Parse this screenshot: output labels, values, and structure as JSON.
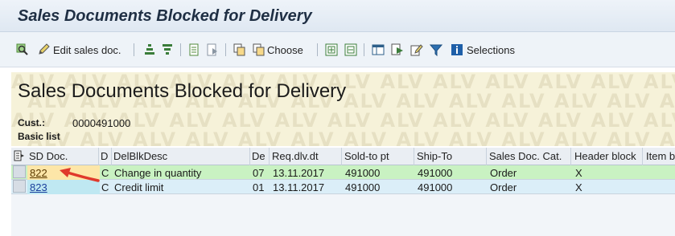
{
  "window": {
    "title": "Sales Documents Blocked for Delivery"
  },
  "toolbar": {
    "edit_label": "Edit sales doc.",
    "choose_label": "Choose",
    "selections_label": "Selections"
  },
  "header": {
    "title": "Sales Documents Blocked for Delivery",
    "cust_label": "Cust.:",
    "cust_value": "0000491000",
    "basic_list": "Basic list",
    "watermark": "ALV"
  },
  "table": {
    "columns": [
      "SD Doc.",
      "D",
      "DelBlkDesc",
      "De",
      "Req.dlv.dt",
      "Sold-to pt",
      "Ship-To",
      "Sales Doc. Cat.",
      "Header block",
      "Item b"
    ],
    "rows": [
      {
        "sd_doc": "822",
        "d": "C",
        "desc": "Change in quantity",
        "de": "07",
        "req_dlv": "13.11.2017",
        "sold_to": "491000",
        "ship_to": "491000",
        "cat": "Order",
        "header_block": "X"
      },
      {
        "sd_doc": "823",
        "d": "C",
        "desc": "Credit limit",
        "de": "01",
        "req_dlv": "13.11.2017",
        "sold_to": "491000",
        "ship_to": "491000",
        "cat": "Order",
        "header_block": "X"
      }
    ]
  },
  "colors": {
    "row_selected": "#c9f2c2",
    "row_normal": "#dbeef8",
    "arrow": "#e0392b"
  }
}
